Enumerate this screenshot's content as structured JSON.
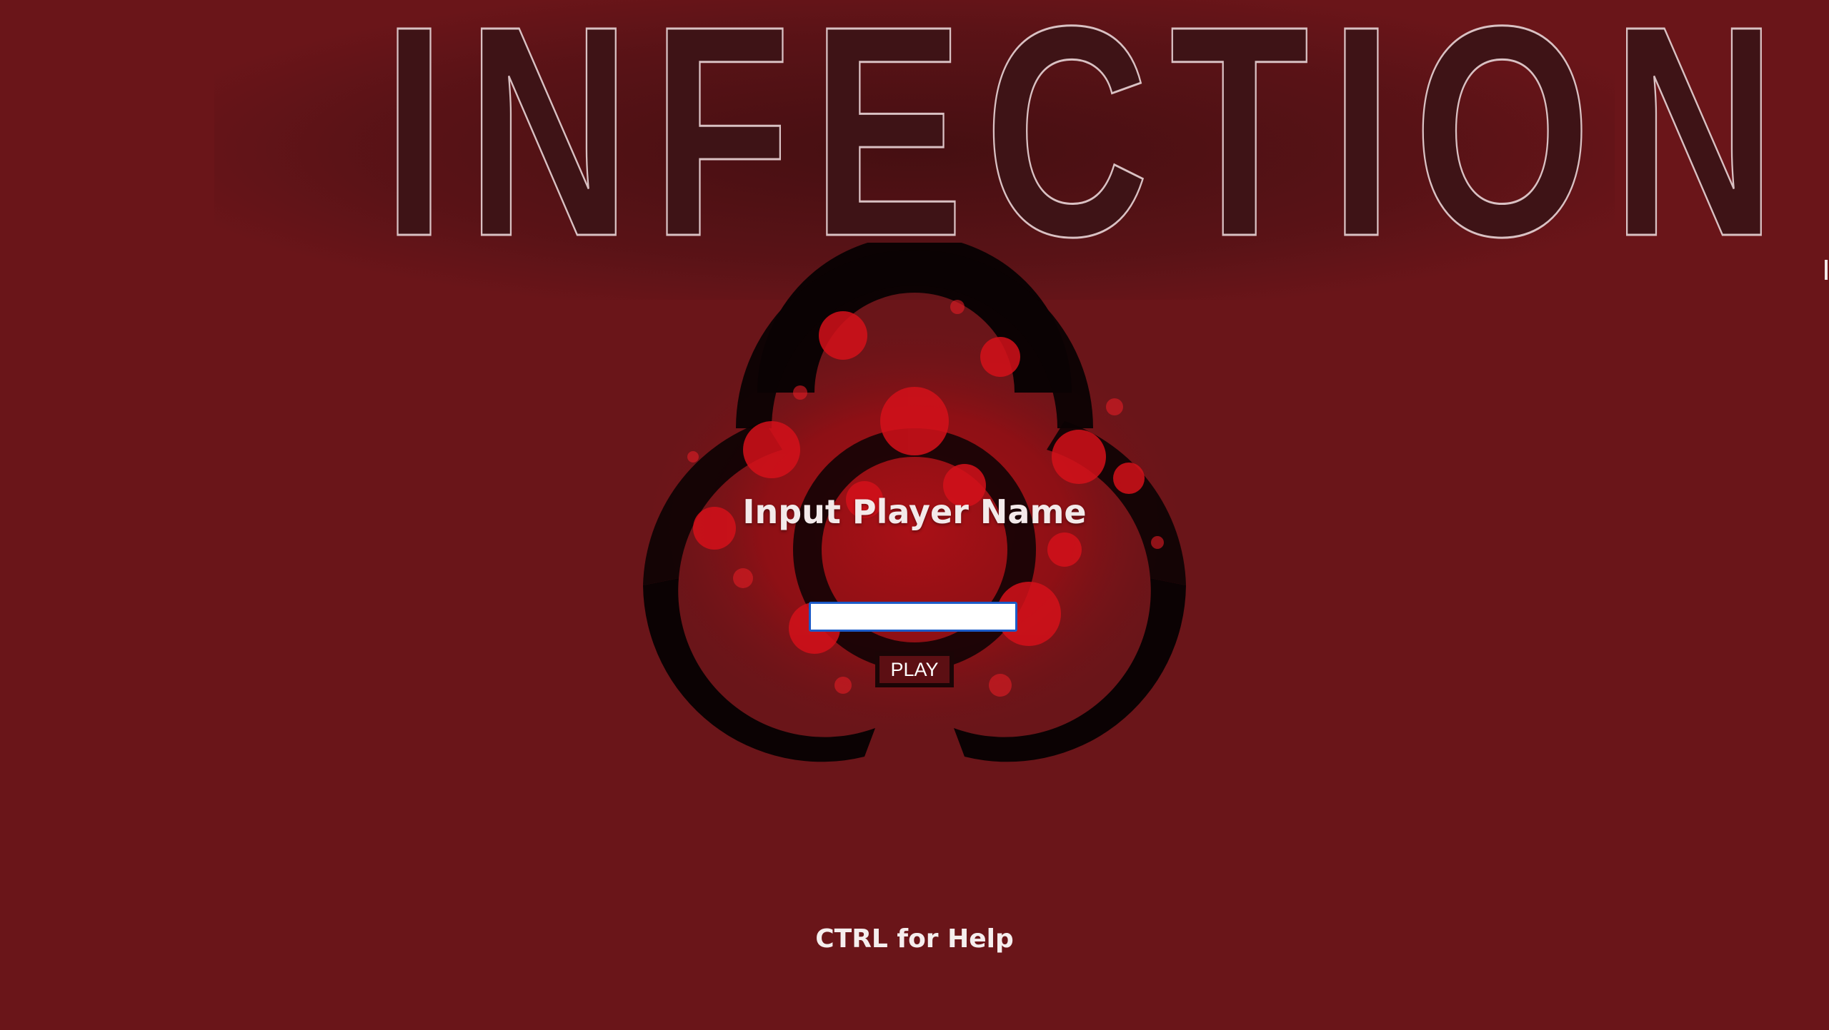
{
  "title": "INFECTION",
  "prompt": "Input Player Name",
  "name_input": {
    "value": "",
    "placeholder": ""
  },
  "play_button_label": "PLAY",
  "help_text": "CTRL for Help",
  "icons": {
    "emblem": "biohazard-icon"
  },
  "colors": {
    "background": "#6a1519",
    "title_fill": "#3e1316",
    "title_outline": "#d9c1c3",
    "emblem": "#0b0203",
    "splatter": "#c30c12",
    "input_focus_ring": "#1c5bc8",
    "button_fill": "#5c0f13"
  }
}
